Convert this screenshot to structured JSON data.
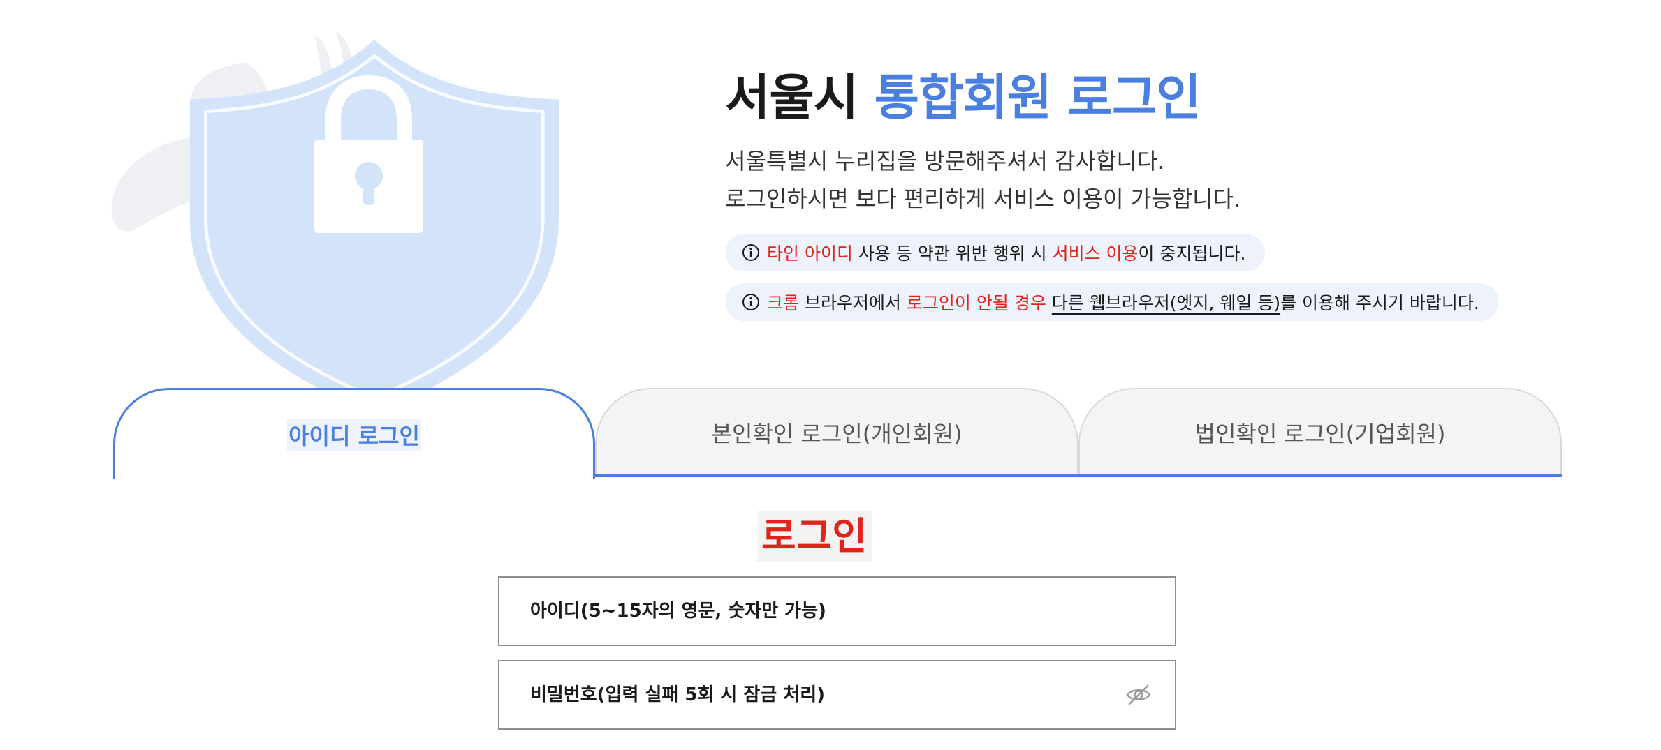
{
  "hero": {
    "title_prefix": "서울시",
    "title_accent": "통합회원 로그인",
    "desc_line1": "서울특별시 누리집을 방문해주셔서 감사합니다.",
    "desc_line2": "로그인하시면 보다 편리하게 서비스 이용이 가능합니다."
  },
  "notices": [
    {
      "icon": "info-icon",
      "red1": "타인 아이디",
      "text1": " 사용 등 약관 위반 행위 시 ",
      "red2": "서비스 이용",
      "text2": "이 중지됩니다."
    },
    {
      "icon": "info-icon",
      "red1": "크롬",
      "text1": " 브라우저에서 ",
      "red2": "로그인이 안될 경우",
      "text2": " ",
      "underlined": "다른 웹브라우저(엣지, 웨일 등)",
      "text3": "를 이용해 주시기 바랍니다."
    }
  ],
  "tabs": [
    {
      "label": "아이디 로그인",
      "active": true
    },
    {
      "label": "본인확인 로그인(개인회원)",
      "active": false
    },
    {
      "label": "법인확인 로그인(기업회원)",
      "active": false
    }
  ],
  "login": {
    "heading": "로그인",
    "id_placeholder": "아이디(5~15자의 영문, 숫자만 가능)",
    "id_value": "",
    "pw_placeholder": "비밀번호(입력 실패 5회 시 잠금 처리)",
    "pw_value": "",
    "pw_toggle_icon": "eye-slash-icon"
  },
  "colors": {
    "accent": "#4a7fe0",
    "alert_red": "#e0241b",
    "notice_bg": "#eef3fb",
    "shield_fill": "#d3e4fa",
    "tab_inactive_bg": "#f3f4f6"
  }
}
